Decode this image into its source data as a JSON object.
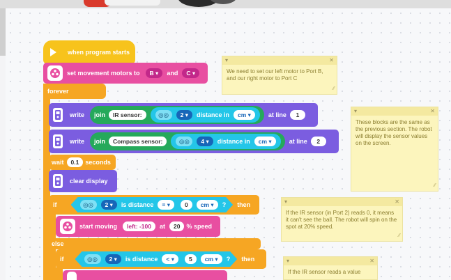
{
  "program": {
    "start_label": "when program starts",
    "set_motors": {
      "label": "set movement motors to",
      "left": "B",
      "and": "and",
      "right": "C"
    },
    "forever_label": "forever",
    "write_1": {
      "write": "write",
      "join": "join",
      "text": "IR sensor:",
      "port": "2",
      "distance_in": "distance in",
      "unit": "cm",
      "at_line": "at line",
      "line": "1"
    },
    "write_2": {
      "write": "write",
      "join": "join",
      "text": "Compass sensor:",
      "port": "4",
      "distance_in": "distance in",
      "unit": "cm",
      "at_line": "at line",
      "line": "2"
    },
    "wait": {
      "label": "wait",
      "value": "0.1",
      "unit": "seconds"
    },
    "clear_display": "clear display",
    "if_1": {
      "if": "if",
      "port": "2",
      "is_distance": "is distance",
      "op": "=",
      "value": "0",
      "unit": "cm",
      "q": "?",
      "then": "then"
    },
    "start_moving": {
      "label": "start moving",
      "dir": "left: -100",
      "at": "at",
      "speed": "20",
      "pct": "% speed"
    },
    "else_label": "else",
    "if_2": {
      "if": "if",
      "port": "2",
      "is_distance": "is distance",
      "op": "<",
      "value": "5",
      "unit": "cm",
      "q": "?",
      "then": "then"
    }
  },
  "notes": [
    {
      "text": "We need to set our left motor to Port B, and our right motor to Port C"
    },
    {
      "text": "These blocks are the same as the previous section. The robot will display the sensor values on the screen."
    },
    {
      "text": "If the IR sensor (in Port 2) reads 0, it means it can't see the ball. The robot will spin on the spot at 20% speed."
    },
    {
      "text": "If the IR sensor reads a value"
    }
  ],
  "icons": {
    "play": "play-icon",
    "motors": "motors-icon",
    "brick": "brick-icon",
    "eyes": "ir-eyes-icon",
    "close": "close-icon",
    "collapse": "collapse-icon"
  },
  "colors": {
    "events": "#f7c31c",
    "control": "#f6a623",
    "motors": "#e84fa1",
    "display": "#7b5de0",
    "operators": "#25a95b",
    "sensors": "#24c6e8",
    "note": "#fcf5bd"
  }
}
